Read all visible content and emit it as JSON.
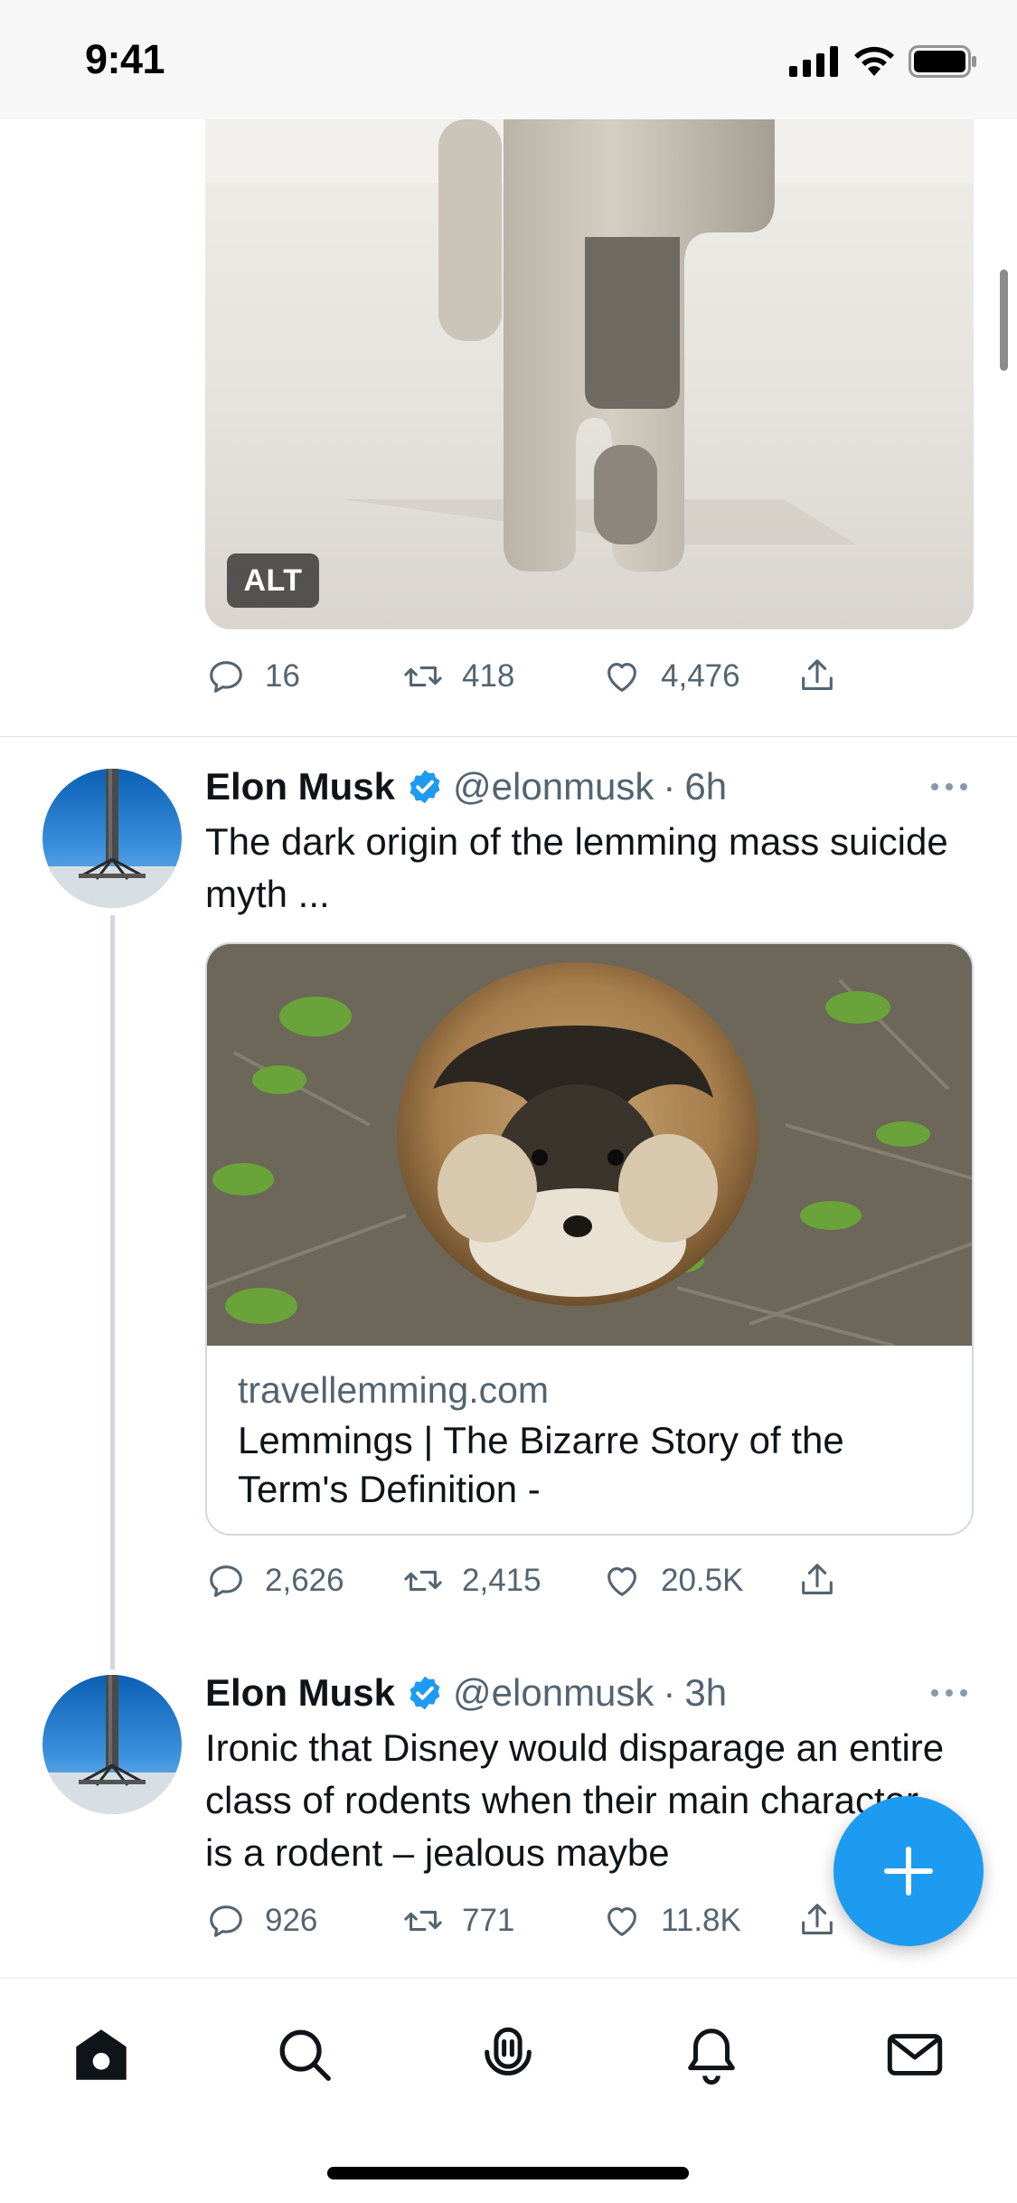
{
  "status_bar": {
    "time": "9:41"
  },
  "tweet_above": {
    "alt_badge": "ALT",
    "actions": {
      "replies": "16",
      "retweets": "418",
      "likes": "4,476"
    }
  },
  "tweet1": {
    "name": "Elon Musk",
    "handle": "@elonmusk",
    "separator": "·",
    "time": "6h",
    "text": "The dark origin of the lemming mass suicide myth ...",
    "card": {
      "domain": "travellemming.com",
      "title": "Lemmings | The Bizarre Story of the Term's Definition -"
    },
    "actions": {
      "replies": "2,626",
      "retweets": "2,415",
      "likes": "20.5K"
    }
  },
  "tweet2": {
    "name": "Elon Musk",
    "handle": "@elonmusk",
    "separator": "·",
    "time": "3h",
    "text": "Ironic that Disney would disparage an entire class of rodents when their main character is a rodent – jealous maybe",
    "actions": {
      "replies": "926",
      "retweets": "771",
      "likes": "11.8K"
    }
  },
  "tab_bar": {
    "items": [
      {
        "icon": "home-icon",
        "active": true
      },
      {
        "icon": "search-icon",
        "active": false
      },
      {
        "icon": "spaces-icon",
        "active": false
      },
      {
        "icon": "notifications-icon",
        "active": false
      },
      {
        "icon": "messages-icon",
        "active": false
      }
    ]
  },
  "colors": {
    "accent": "#1d9bf0",
    "text": "#0f1419",
    "secondary": "#536471",
    "divider": "#cfd9de"
  }
}
